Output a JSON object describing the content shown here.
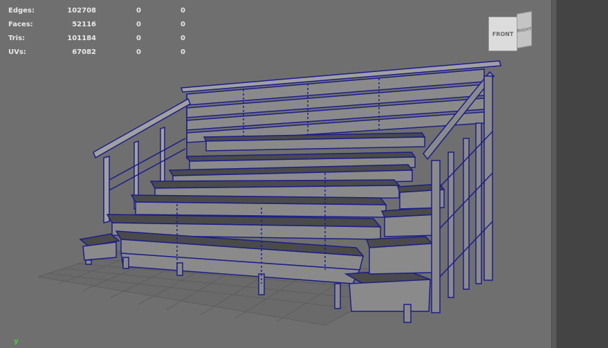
{
  "hud": {
    "rows": [
      {
        "label": "Edges:",
        "v1": "102708",
        "v2": "0",
        "v3": "0"
      },
      {
        "label": "Faces:",
        "v1": "52116",
        "v2": "0",
        "v3": "0"
      },
      {
        "label": "Tris:",
        "v1": "101184",
        "v2": "0",
        "v3": "0"
      },
      {
        "label": "UVs:",
        "v1": "67082",
        "v2": "0",
        "v3": "0"
      }
    ]
  },
  "viewcube": {
    "front": "FRONT",
    "right": "RIGHT"
  },
  "axis": {
    "y": "y"
  },
  "colors": {
    "wire": "#1c1c8c",
    "surface": "#8a8a8a",
    "tread": "#4a4a4a",
    "grid": "#5e5e5e"
  }
}
